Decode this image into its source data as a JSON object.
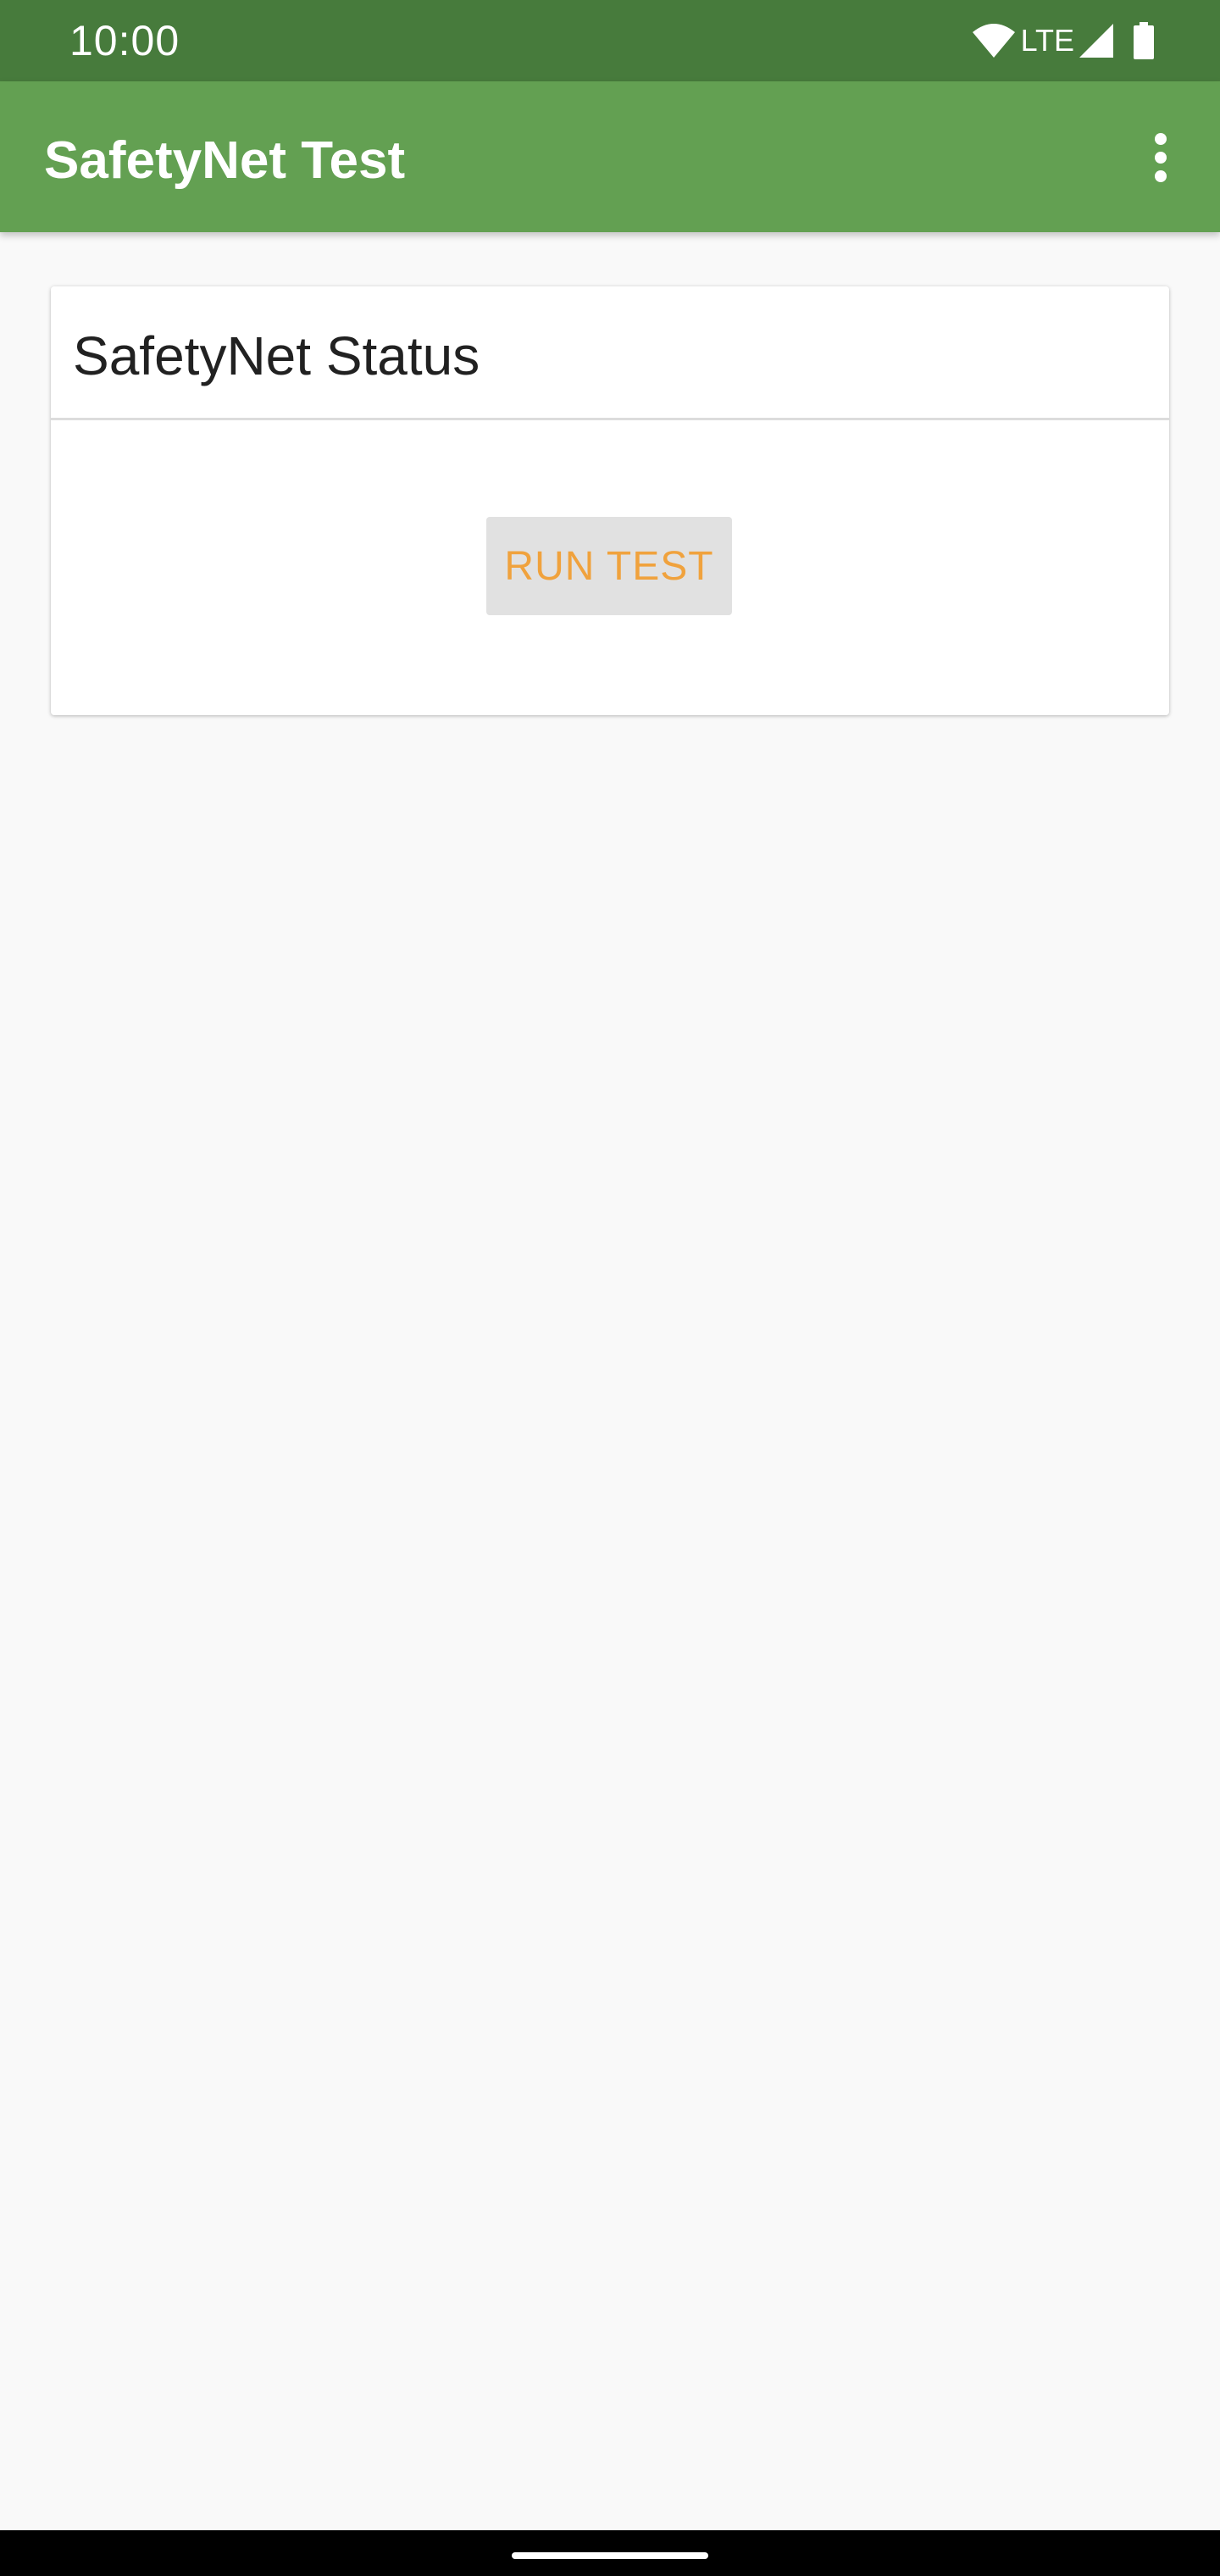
{
  "status_bar": {
    "time": "10:00",
    "network_label": "LTE",
    "icons": [
      "wifi-icon",
      "signal-icon",
      "battery-icon"
    ]
  },
  "app_bar": {
    "title": "SafetyNet Test",
    "overflow_icon": "more-vert-icon"
  },
  "card": {
    "title": "SafetyNet Status",
    "run_button_label": "RUN TEST"
  },
  "colors": {
    "status_bar": "#477b3c",
    "app_bar": "#63a052",
    "background": "#f9f9f9",
    "button_background": "#e1e1e1",
    "button_text": "#f0a23d",
    "nav_bar": "#000000"
  }
}
